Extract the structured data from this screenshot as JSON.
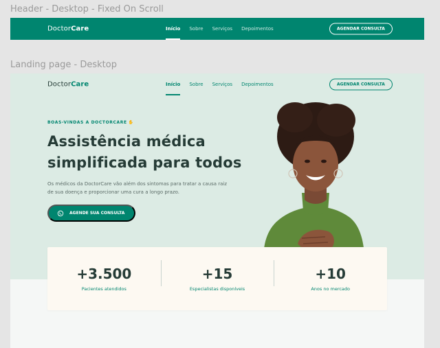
{
  "frames": {
    "fixed_header_label": "Header - Desktop - Fixed On Scroll",
    "landing_label": "Landing page - Desktop"
  },
  "brand": {
    "name_part1": "Doctor",
    "name_part2": "Care",
    "primary_color": "#00856f",
    "dark_text_color": "#253b36",
    "hero_bg_color": "#dcebe4"
  },
  "nav": {
    "items": [
      "Início",
      "Sobre",
      "Serviços",
      "Depoimentos"
    ],
    "active_index": 0,
    "cta_label": "AGENDAR CONSULTA"
  },
  "hero": {
    "welcome": "BOAS-VINDAS A DOCTORCARE",
    "welcome_icon": "waving-hand-icon",
    "title": "Assistência médica simplificada para todos",
    "subtitle": "Os médicos da DoctorCare vão além dos sintomas para tratar a causa raiz de sua doença e proporcionar uma cura a longo prazo.",
    "cta_label": "AGENDE SUA CONSULTA",
    "cta_icon": "whatsapp-icon"
  },
  "stats": [
    {
      "value": "+3.500",
      "label": "Pacientes atendidos"
    },
    {
      "value": "+15",
      "label": "Especialistas disponíveis"
    },
    {
      "value": "+10",
      "label": "Anos no mercado"
    }
  ]
}
